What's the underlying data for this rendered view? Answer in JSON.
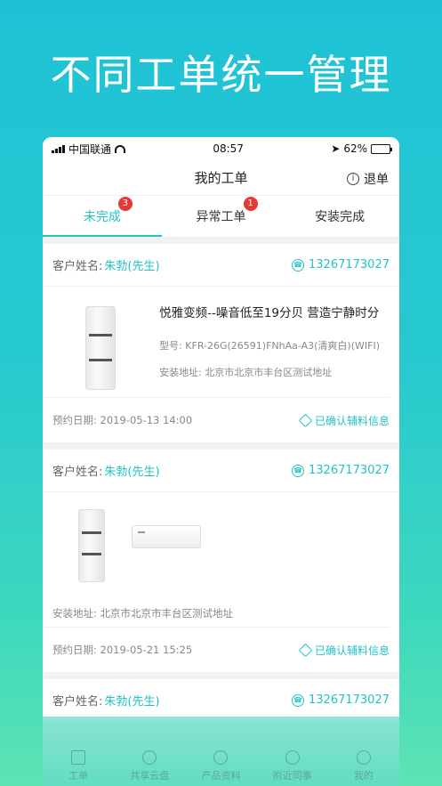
{
  "hero": {
    "title": "不同工单统一管理"
  },
  "status_bar": {
    "carrier": "中国联通",
    "time": "08:57",
    "battery": "62%",
    "battery_level": 0.62
  },
  "nav": {
    "title": "我的工单",
    "right_label": "退单"
  },
  "tabs": [
    {
      "label": "未完成",
      "badge": "3",
      "active": true
    },
    {
      "label": "异常工单",
      "badge": "1",
      "active": false
    },
    {
      "label": "安装完成",
      "badge": "",
      "active": false
    }
  ],
  "orders": [
    {
      "customer_label": "客户姓名:",
      "customer_name": "朱勃(先生)",
      "phone": "13267173027",
      "product_title": "悦雅变频--噪音低至19分贝 营造宁静时分",
      "model": "型号:  KFR-26G(26591)FNhAa-A3(清爽白)(WIFI)",
      "address": "安装地址:   北京市北京市丰台区测试地址",
      "date": "预约日期:  2019-05-13 14:00",
      "status": "已确认辅料信息"
    },
    {
      "customer_label": "客户姓名:",
      "customer_name": "朱勃(先生)",
      "phone": "13267173027",
      "address": "安装地址:   北京市北京市丰台区测试地址",
      "date": "预约日期:  2019-05-21 15:25",
      "status": "已确认辅料信息"
    },
    {
      "customer_label": "客户姓名:",
      "customer_name": "朱勃(先生)",
      "phone": "13267173027"
    }
  ],
  "tabbar": [
    {
      "label": "工单",
      "icon": "document-icon"
    },
    {
      "label": "共享云盘",
      "icon": "cloud-disk-icon"
    },
    {
      "label": "产品资料",
      "icon": "compass-icon"
    },
    {
      "label": "附近同事",
      "icon": "location-icon"
    },
    {
      "label": "我的",
      "icon": "person-icon"
    }
  ]
}
